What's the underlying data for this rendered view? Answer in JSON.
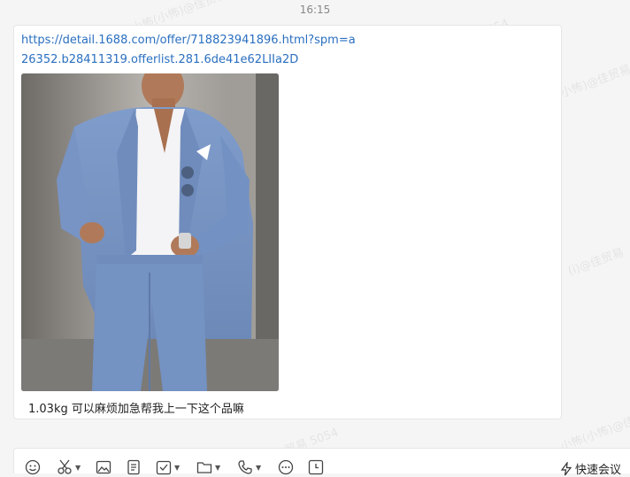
{
  "timestamp": "16:15",
  "message": {
    "link_text": "https://detail.1688.com/offer/718823941896.html?spm=a26352.b28411319.offerlist.281.6de41e62LIIa2D",
    "caption": "1.03kg  可以麻烦加急帮我上一下这个品嘛"
  },
  "watermarks": [
    "小怖(小怖)@佳贸易",
    "佳贸易 5054",
    "小怖(小怖)@佳贸易 5054",
    "(i)@佳贸易",
    "小怖(小怖)@佳贸易",
    "贸易 5054"
  ],
  "toolbar": {
    "items": [
      "emoji-icon",
      "scissors-icon",
      "image-icon",
      "document-icon",
      "checkbox-icon",
      "folder-icon",
      "phone-icon",
      "chat-bubble-icon",
      "clock-icon"
    ],
    "quick_meeting_label": "快速会议"
  },
  "colors": {
    "background": "#f5f5f5",
    "link": "#2a6fc0",
    "bubble": "#ffffff"
  }
}
